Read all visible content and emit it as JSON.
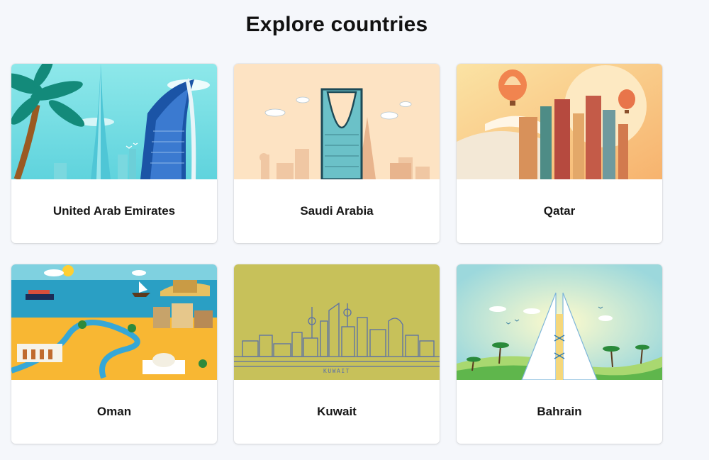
{
  "page": {
    "title": "Explore countries"
  },
  "countries": [
    {
      "name": "United Arab Emirates",
      "illustration": "dubai-skyline-illustration",
      "accent": "#7fe0e6"
    },
    {
      "name": "Saudi Arabia",
      "illustration": "riyadh-skyline-illustration",
      "accent": "#fde3c3"
    },
    {
      "name": "Qatar",
      "illustration": "doha-skyline-illustration",
      "accent": "#f6c98a"
    },
    {
      "name": "Oman",
      "illustration": "oman-map-illustration",
      "accent": "#f8b733"
    },
    {
      "name": "Kuwait",
      "illustration": "kuwait-skyline-illustration",
      "accent": "#c7c15a",
      "art_text": "KUWAIT"
    },
    {
      "name": "Bahrain",
      "illustration": "manama-towers-illustration",
      "accent": "#bfe6e2"
    }
  ]
}
